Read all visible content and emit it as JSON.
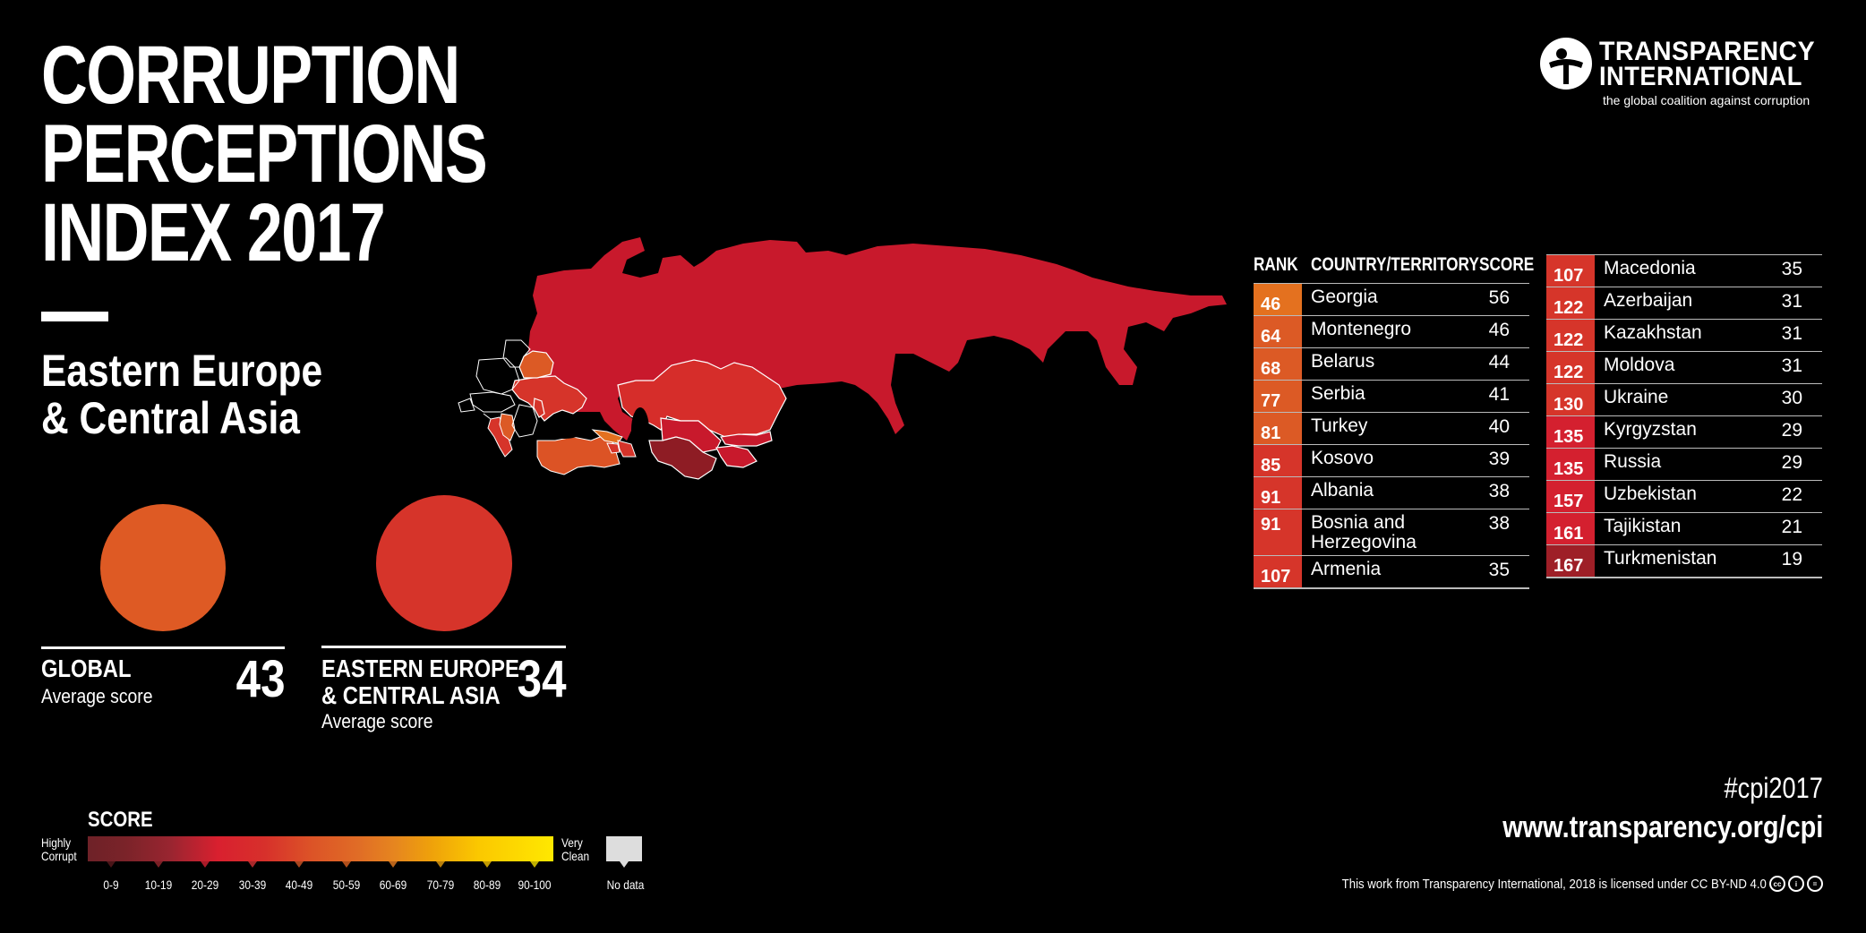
{
  "title": {
    "lines": [
      "CORRUPTION",
      "PERCEPTIONS",
      "INDEX 2017"
    ],
    "region_lines": [
      "Eastern Europe",
      "& Central Asia"
    ]
  },
  "logo": {
    "line1": "TRANSPARENCY",
    "line2": "INTERNATIONAL",
    "tagline": "the global coalition against corruption",
    "icon": "transparency-international-logo-icon"
  },
  "averages": {
    "global": {
      "label": "GLOBAL",
      "sub": "Average score",
      "value": "43",
      "color": "#de5a24"
    },
    "region": {
      "label_lines": [
        "EASTERN EUROPE",
        "& CENTRAL ASIA"
      ],
      "sub": "Average score",
      "value": "34",
      "color": "#d6342a"
    }
  },
  "table": {
    "headers": {
      "rank": "RANK",
      "country": "COUNTRY/TERRITORY",
      "score": "SCORE"
    },
    "left": [
      {
        "rank": "46",
        "country": "Georgia",
        "score": "56",
        "color": "#e4711f"
      },
      {
        "rank": "64",
        "country": "Montenegro",
        "score": "46",
        "color": "#dc5a25"
      },
      {
        "rank": "68",
        "country": "Belarus",
        "score": "44",
        "color": "#dc5a25"
      },
      {
        "rank": "77",
        "country": "Serbia",
        "score": "41",
        "color": "#dc5a25"
      },
      {
        "rank": "81",
        "country": "Turkey",
        "score": "40",
        "color": "#dc5a25"
      },
      {
        "rank": "85",
        "country": "Kosovo",
        "score": "39",
        "color": "#d6352a"
      },
      {
        "rank": "91",
        "country": "Albania",
        "score": "38",
        "color": "#d6352a"
      },
      {
        "rank": "91",
        "country": "Bosnia and Herzegovina",
        "score": "38",
        "color": "#d6352a"
      },
      {
        "rank": "107",
        "country": "Armenia",
        "score": "35",
        "color": "#d6352a"
      }
    ],
    "right": [
      {
        "rank": "107",
        "country": "Macedonia",
        "score": "35",
        "color": "#d6352a"
      },
      {
        "rank": "122",
        "country": "Azerbaijan",
        "score": "31",
        "color": "#d6352a"
      },
      {
        "rank": "122",
        "country": "Kazakhstan",
        "score": "31",
        "color": "#d6352a"
      },
      {
        "rank": "122",
        "country": "Moldova",
        "score": "31",
        "color": "#d6352a"
      },
      {
        "rank": "130",
        "country": "Ukraine",
        "score": "30",
        "color": "#d6352a"
      },
      {
        "rank": "135",
        "country": "Kyrgyzstan",
        "score": "29",
        "color": "#d4202f"
      },
      {
        "rank": "135",
        "country": "Russia",
        "score": "29",
        "color": "#d4202f"
      },
      {
        "rank": "157",
        "country": "Uzbekistan",
        "score": "22",
        "color": "#d4202f"
      },
      {
        "rank": "161",
        "country": "Tajikistan",
        "score": "21",
        "color": "#d4202f"
      },
      {
        "rank": "167",
        "country": "Turkmenistan",
        "score": "19",
        "color": "#9e1f27"
      }
    ]
  },
  "legend": {
    "title": "SCORE",
    "low_label": [
      "Highly",
      "Corrupt"
    ],
    "high_label": [
      "Very",
      "Clean"
    ],
    "bins": [
      "0-9",
      "10-19",
      "20-29",
      "30-39",
      "40-49",
      "50-59",
      "60-69",
      "70-79",
      "80-89",
      "90-100"
    ],
    "no_data": "No data"
  },
  "footer": {
    "hashtag": "#cpi2017",
    "url": "www.transparency.org/cpi",
    "license": "This work from Transparency International, 2018 is licensed under CC BY-ND 4.0",
    "license_icons": [
      "cc-icon",
      "by-icon",
      "nd-icon"
    ]
  },
  "map": {
    "colors": {
      "russia": "#c8192c",
      "kazakhstan": "#d62d2a",
      "ukraine": "#d6342a",
      "belarus": "#dc5a25",
      "turkey": "#dc5325",
      "georgia": "#e4711f",
      "turkmenistan": "#8e1c24",
      "uzbekistan": "#c8192c",
      "no_highlight": "#000000"
    }
  }
}
